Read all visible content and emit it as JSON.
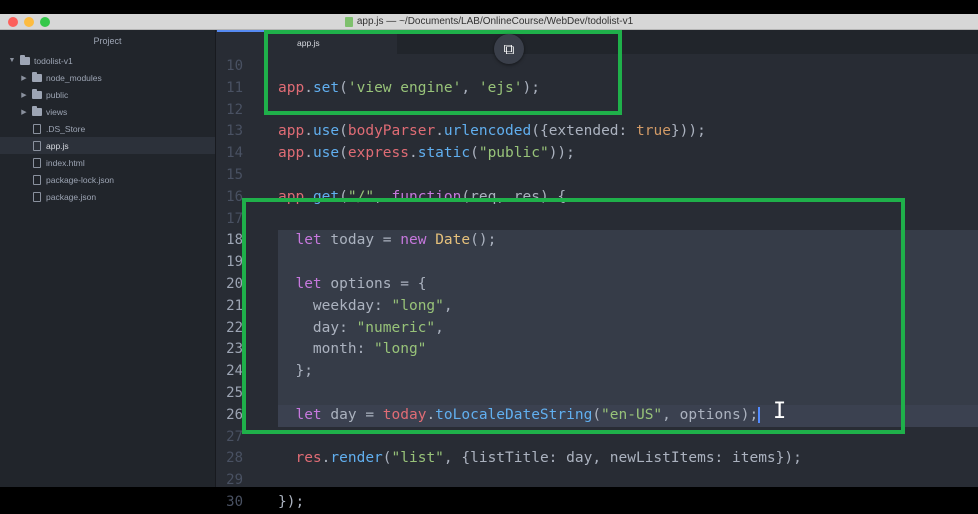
{
  "window": {
    "title": "app.js — ~/Documents/LAB/OnlineCourse/WebDev/todolist-v1"
  },
  "sidebar": {
    "header": "Project",
    "items": [
      {
        "label": "todolist-v1",
        "type": "folder",
        "expanded": true,
        "depth": 0,
        "selected": false
      },
      {
        "label": "node_modules",
        "type": "folder",
        "expanded": false,
        "depth": 1,
        "selected": false
      },
      {
        "label": "public",
        "type": "folder",
        "expanded": false,
        "depth": 1,
        "selected": false
      },
      {
        "label": "views",
        "type": "folder",
        "expanded": false,
        "depth": 1,
        "selected": false
      },
      {
        "label": ".DS_Store",
        "type": "file",
        "depth": 1,
        "selected": false
      },
      {
        "label": "app.js",
        "type": "file",
        "depth": 1,
        "selected": true
      },
      {
        "label": "index.html",
        "type": "file",
        "depth": 1,
        "selected": false
      },
      {
        "label": "package-lock.json",
        "type": "file",
        "depth": 1,
        "selected": false
      },
      {
        "label": "package.json",
        "type": "file",
        "depth": 1,
        "selected": false
      }
    ]
  },
  "editor": {
    "active_tab": "app.js",
    "line_numbers": [
      "10",
      "11",
      "12",
      "13",
      "14",
      "15",
      "16",
      "17",
      "18",
      "19",
      "20",
      "21",
      "22",
      "23",
      "24",
      "25",
      "26",
      "27",
      "28",
      "29",
      "30"
    ],
    "highlighted_lines": [
      "18",
      "19",
      "20",
      "21",
      "22",
      "23",
      "24",
      "25",
      "26"
    ],
    "code": {
      "l11": {
        "obj": "app",
        "dot": ".",
        "fn": "set",
        "p1": "(",
        "s1": "'view engine'",
        "c": ", ",
        "s2": "'ejs'",
        "end": ");"
      },
      "l13": {
        "obj": "app",
        "dot": ".",
        "fn": "use",
        "p1": "(",
        "fn2": "bodyParser",
        "dot2": ".",
        "fn3": "urlencoded",
        "p2": "({extended: ",
        "kw": "true",
        "end": "}));"
      },
      "l14": {
        "obj": "app",
        "dot": ".",
        "fn": "use",
        "p1": "(",
        "fn2": "express",
        "dot2": ".",
        "fn3": "static",
        "p2": "(",
        "s1": "\"public\"",
        "end": "));"
      },
      "l16": {
        "obj": "app",
        "dot": ".",
        "fn": "get",
        "p1": "(",
        "s1": "\"/\"",
        "c": ", ",
        "kw": "function",
        "end": "(req, res) {"
      },
      "l18": {
        "indent": "  ",
        "kw": "let",
        "mid": " today = ",
        "kw2": "new",
        "sp": " ",
        "cls": "Date",
        "end": "();"
      },
      "l20": {
        "indent": "  ",
        "kw": "let",
        "end": " options = {"
      },
      "l21": {
        "indent": "    ",
        "key": "weekday: ",
        "s1": "\"long\"",
        "end": ","
      },
      "l22": {
        "indent": "    ",
        "key": "day: ",
        "s1": "\"numeric\"",
        "end": ","
      },
      "l23": {
        "indent": "    ",
        "key": "month: ",
        "s1": "\"long\"",
        "end": ""
      },
      "l24": {
        "indent": "  ",
        "end": "};"
      },
      "l26": {
        "indent": "  ",
        "kw": "let",
        "mid": " day = ",
        "obj": "today",
        "dot": ".",
        "fn": "toLocaleDateString",
        "p1": "(",
        "s1": "\"en-US\"",
        "end": ", options);"
      },
      "l28": {
        "indent": "  ",
        "obj": "res",
        "dot": ".",
        "fn": "render",
        "p1": "(",
        "s1": "\"list\"",
        "end": ", {listTitle: day, newListItems: items});"
      },
      "l30": {
        "end": "});"
      }
    }
  },
  "colors": {
    "annotation": "#1fb04a",
    "keyword": "#c678dd",
    "object": "#e06c75",
    "function": "#61afef",
    "string": "#98c379",
    "class": "#e5c07b",
    "boolean": "#d19a66"
  },
  "icons": {
    "float_button": "popout-icon",
    "text_cursor": "ibeam-cursor-icon"
  }
}
